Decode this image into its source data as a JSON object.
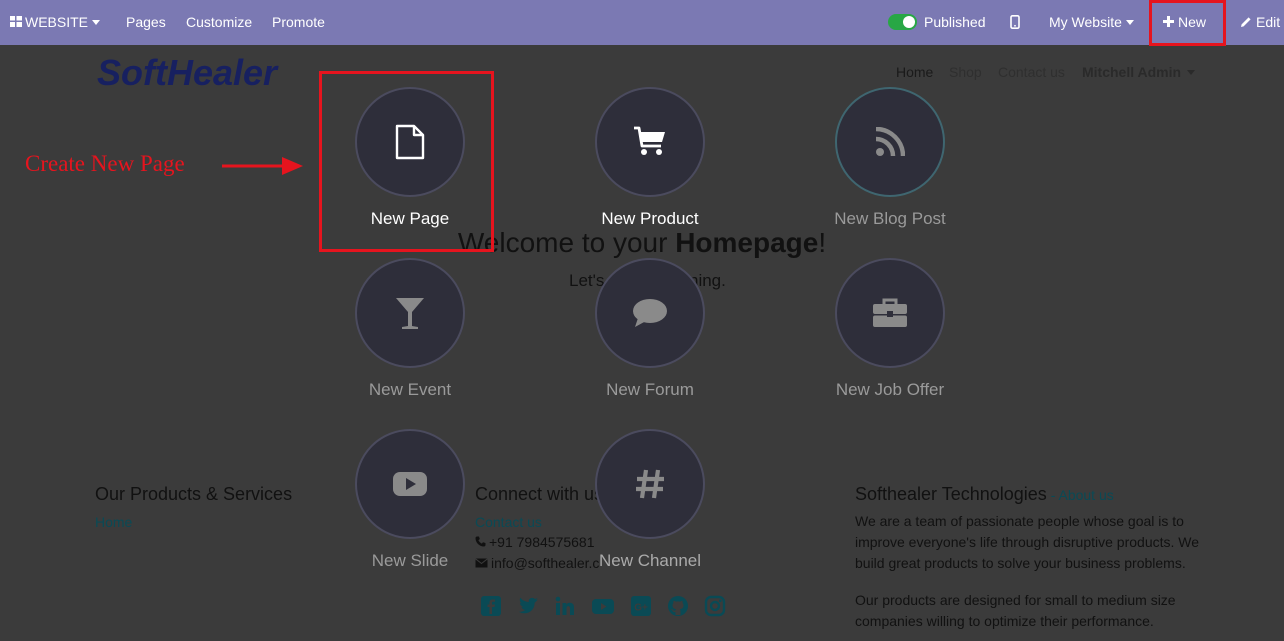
{
  "topbar": {
    "app_label": "WEBSITE",
    "menu": [
      "Pages",
      "Customize",
      "Promote"
    ],
    "published_label": "Published",
    "site_selector": "My Website",
    "new_label": "New",
    "edit_label": "Edit"
  },
  "site": {
    "logo_text": "SoftHealer",
    "nav": [
      "Home",
      "Shop",
      "Contact us"
    ],
    "user": "Mitchell Admin",
    "welcome_prefix": "Welcome to your ",
    "welcome_bold": "Homepage",
    "welcome_suffix": "!",
    "subtitle_left": "Let's",
    "subtitle_right": "ning."
  },
  "footer": {
    "col1_title": "Our Products & Services",
    "col1_link": "Home",
    "col2_title": "Connect with us",
    "col2_link": "Contact us",
    "phone": "+91 7984575681",
    "email": "info@softhealer.c",
    "col3_title": "Softhealer Technologies",
    "col3_sep": " - ",
    "col3_link": "About us",
    "col3_p1": "We are a team of passionate people whose goal is to improve everyone's life through disruptive products. We build great products to solve your business problems.",
    "col3_p2": "Our products are designed for small to medium size companies willing to optimize their performance."
  },
  "new_menu": {
    "items": [
      {
        "label": "New Page",
        "icon": "file-icon"
      },
      {
        "label": "New Product",
        "icon": "shopping-cart-icon"
      },
      {
        "label": "New Blog Post",
        "icon": "rss-icon"
      },
      {
        "label": "New Event",
        "icon": "glass-icon"
      },
      {
        "label": "New Forum",
        "icon": "comment-icon"
      },
      {
        "label": "New Job Offer",
        "icon": "briefcase-icon"
      },
      {
        "label": "New Slide",
        "icon": "youtube-play-icon"
      },
      {
        "label": "New Channel",
        "icon": "hashtag-icon"
      }
    ]
  },
  "annotation": {
    "text": "Create New Page",
    "color": "#e6141e"
  },
  "colors": {
    "topbar": "#7b79b3",
    "overlay": "#3b3b3b",
    "published_toggle": "#28a745"
  }
}
